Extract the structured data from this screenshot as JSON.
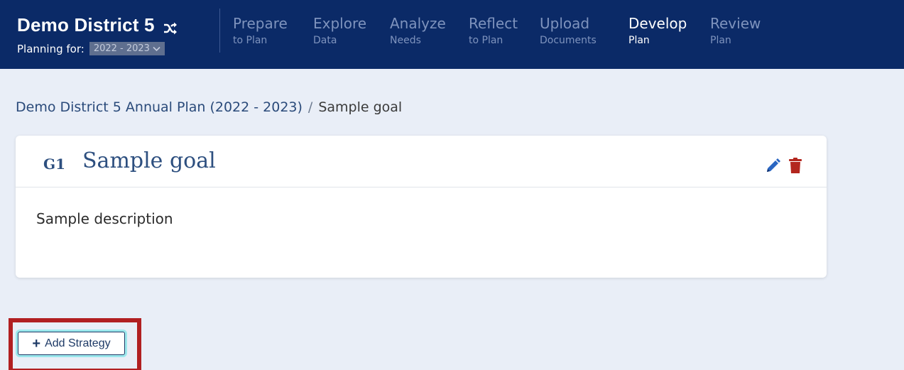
{
  "navbar": {
    "district_name": "Demo District 5",
    "planning_label": "Planning for:",
    "year_selected": "2022 - 2023",
    "steps": [
      {
        "line1": "Prepare",
        "line2": "to Plan",
        "active": false
      },
      {
        "line1": "Explore",
        "line2": "Data",
        "active": false
      },
      {
        "line1": "Analyze",
        "line2": "Needs",
        "active": false
      },
      {
        "line1": "Reflect",
        "line2": "to Plan",
        "active": false
      },
      {
        "line1": "Upload",
        "line2": "Documents",
        "active": false
      },
      {
        "line1": "Develop",
        "line2": "Plan",
        "active": true
      },
      {
        "line1": "Review",
        "line2": "Plan",
        "active": false
      }
    ]
  },
  "breadcrumb": {
    "parent": "Demo District 5 Annual Plan (2022 - 2023)",
    "separator": "/",
    "current": "Sample goal"
  },
  "goal": {
    "code": "G1",
    "title": "Sample goal",
    "description": "Sample description"
  },
  "actions": {
    "add_strategy_label": "Add Strategy"
  },
  "colors": {
    "navbar_bg": "#0b2a67",
    "page_bg": "#e9eef7",
    "accent_text": "#2d4f7f",
    "edit_icon": "#2a66c2",
    "delete_icon": "#b3261e",
    "highlight": "#b11f21",
    "focus_ring": "#9ce8ec"
  },
  "icons": {
    "switch_district": "shuffle-icon",
    "year_dropdown": "chevron-down-icon",
    "edit_goal": "pencil-icon",
    "delete_goal": "trash-icon",
    "add_strategy": "plus-icon"
  }
}
